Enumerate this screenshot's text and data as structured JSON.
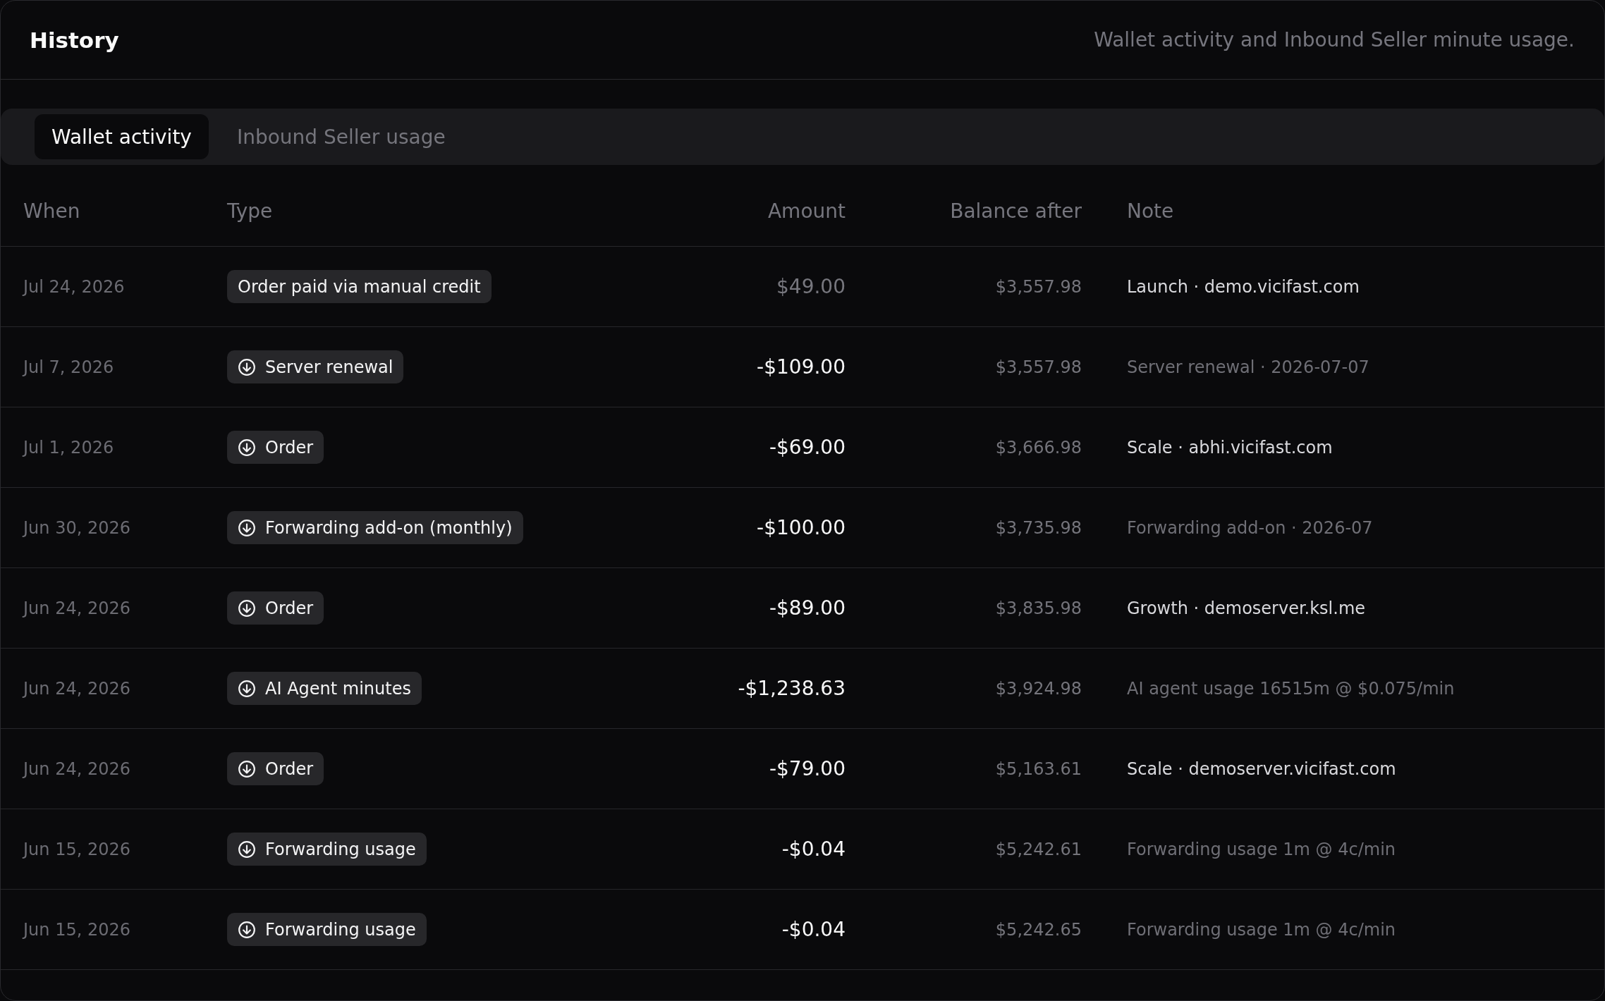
{
  "panel": {
    "title": "History",
    "subtitle": "Wallet activity and Inbound Seller minute usage."
  },
  "tabs": [
    {
      "label": "Wallet activity",
      "selected": true
    },
    {
      "label": "Inbound Seller usage",
      "selected": false
    }
  ],
  "table": {
    "columns": [
      "When",
      "Type",
      "Amount",
      "Balance after",
      "Note"
    ],
    "rows": [
      {
        "when": "Jul 24, 2026",
        "kind": "credit",
        "type": "Order paid via manual credit",
        "amount": "$49.00",
        "balance_after": "$3,557.98",
        "note": "Launch · demo.vicifast.com",
        "note_muted": false
      },
      {
        "when": "Jul 7, 2026",
        "kind": "debit",
        "type": "Server renewal",
        "amount": "-$109.00",
        "balance_after": "$3,557.98",
        "note": "Server renewal · 2026-07-07",
        "note_muted": true
      },
      {
        "when": "Jul 1, 2026",
        "kind": "debit",
        "type": "Order",
        "amount": "-$69.00",
        "balance_after": "$3,666.98",
        "note": "Scale · abhi.vicifast.com",
        "note_muted": false
      },
      {
        "when": "Jun 30, 2026",
        "kind": "debit",
        "type": "Forwarding add-on (monthly)",
        "amount": "-$100.00",
        "balance_after": "$3,735.98",
        "note": "Forwarding add-on · 2026-07",
        "note_muted": true
      },
      {
        "when": "Jun 24, 2026",
        "kind": "debit",
        "type": "Order",
        "amount": "-$89.00",
        "balance_after": "$3,835.98",
        "note": "Growth · demoserver.ksl.me",
        "note_muted": false
      },
      {
        "when": "Jun 24, 2026",
        "kind": "debit",
        "type": "AI Agent minutes",
        "amount": "-$1,238.63",
        "balance_after": "$3,924.98",
        "note": "AI agent usage 16515m @ $0.075/min",
        "note_muted": true
      },
      {
        "when": "Jun 24, 2026",
        "kind": "debit",
        "type": "Order",
        "amount": "-$79.00",
        "balance_after": "$5,163.61",
        "note": "Scale · demoserver.vicifast.com",
        "note_muted": false
      },
      {
        "when": "Jun 15, 2026",
        "kind": "debit",
        "type": "Forwarding usage",
        "amount": "-$0.04",
        "balance_after": "$5,242.61",
        "note": "Forwarding usage 1m @ 4c/min",
        "note_muted": true
      },
      {
        "when": "Jun 15, 2026",
        "kind": "debit",
        "type": "Forwarding usage",
        "amount": "-$0.04",
        "balance_after": "$5,242.65",
        "note": "Forwarding usage 1m @ 4c/min",
        "note_muted": true
      }
    ]
  }
}
